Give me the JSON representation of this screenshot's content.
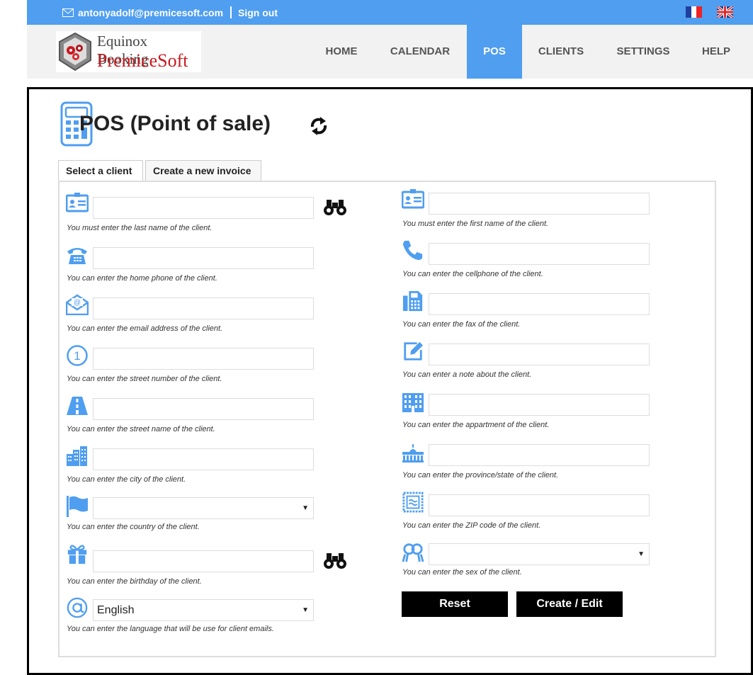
{
  "header": {
    "email": "antonyadolf@premicesoft.com",
    "signout": "Sign out",
    "lang_fr": "fr-flag-icon",
    "lang_en": "uk-flag-icon"
  },
  "logo": {
    "line1": "Equinox Booking",
    "line2": "PremiceSoft"
  },
  "nav": [
    {
      "label": "HOME",
      "active": false
    },
    {
      "label": "CALENDAR",
      "active": false
    },
    {
      "label": "POS",
      "active": true
    },
    {
      "label": "CLIENTS",
      "active": false
    },
    {
      "label": "SETTINGS",
      "active": false
    },
    {
      "label": "HELP",
      "active": false
    }
  ],
  "page": {
    "title": "POS (Point of sale)"
  },
  "tabs": [
    {
      "label": "Select a client",
      "active": true
    },
    {
      "label": "Create a new invoice",
      "active": false
    }
  ],
  "left_fields": [
    {
      "icon": "id-card-icon",
      "value": "",
      "hint": "You must enter the last name of the client."
    },
    {
      "icon": "home-phone-icon",
      "value": "",
      "hint": "You can enter the home phone of the client."
    },
    {
      "icon": "email-icon",
      "value": "",
      "hint": "You can enter the email address of the client."
    },
    {
      "icon": "number-one-icon",
      "value": "",
      "hint": "You can enter the street number of the client."
    },
    {
      "icon": "road-icon",
      "value": "",
      "hint": "You can enter the street name of the client."
    },
    {
      "icon": "city-icon",
      "value": "",
      "hint": "You can enter the city of the client."
    },
    {
      "icon": "flag-icon",
      "value": "",
      "hint": "You can enter the country of the client."
    },
    {
      "icon": "gift-icon",
      "value": "",
      "hint": "You can enter the birthday of the client."
    },
    {
      "icon": "at-icon",
      "value": "English",
      "hint": "You can enter the language that will be use for client emails."
    }
  ],
  "right_fields": [
    {
      "icon": "id-card-icon",
      "value": "",
      "hint": "You must enter the first name of the client."
    },
    {
      "icon": "cellphone-icon",
      "value": "",
      "hint": "You can enter the cellphone of the client."
    },
    {
      "icon": "fax-icon",
      "value": "",
      "hint": "You can enter the fax of the client."
    },
    {
      "icon": "note-edit-icon",
      "value": "",
      "hint": "You can enter a note about the client."
    },
    {
      "icon": "apartment-building-icon",
      "value": "",
      "hint": "You can enter the appartment of the client."
    },
    {
      "icon": "capitol-icon",
      "value": "",
      "hint": "You can enter the province/state of the client."
    },
    {
      "icon": "stamp-icon",
      "value": "",
      "hint": "You can enter the ZIP code of the client."
    },
    {
      "icon": "gender-icon",
      "value": "",
      "hint": "You can enter the sex of the client."
    }
  ],
  "buttons": {
    "reset": "Reset",
    "create_edit": "Create / Edit"
  },
  "colors": {
    "accent": "#4f9ef0",
    "icon": "#4f9ef0",
    "button": "#000000"
  }
}
